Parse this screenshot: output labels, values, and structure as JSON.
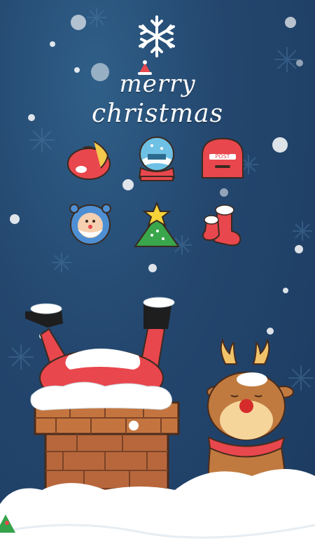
{
  "header": {
    "title_line1": "merry",
    "title_line2": "christmas"
  },
  "apps": [
    {
      "name": "sack-icon"
    },
    {
      "name": "snow-globe-icon"
    },
    {
      "name": "mailbox-icon"
    },
    {
      "name": "santa-clock-icon"
    },
    {
      "name": "christmas-tree-icon"
    },
    {
      "name": "stocking-icon"
    }
  ],
  "mailbox_label": "POST",
  "colors": {
    "background": "#1f4066",
    "red": "#e8474d",
    "brick": "#b8673d",
    "snow": "#ffffff",
    "reindeer": "#c07a3f"
  }
}
